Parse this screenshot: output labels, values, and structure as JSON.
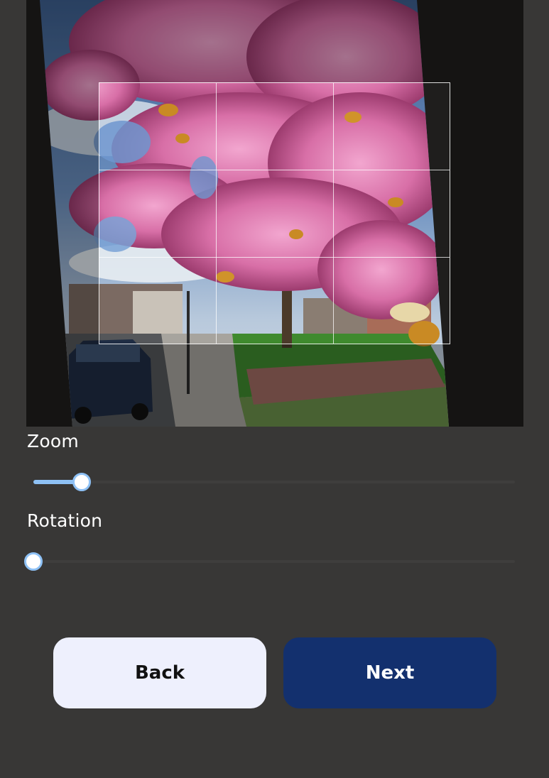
{
  "crop_editor": {
    "grid": "3x3",
    "image_description_icon": "photo-image"
  },
  "controls": {
    "zoom": {
      "label": "Zoom",
      "value_fraction": 0.1
    },
    "rotation": {
      "label": "Rotation",
      "value_fraction": 0.0
    }
  },
  "buttons": {
    "back_label": "Back",
    "next_label": "Next"
  },
  "colors": {
    "background": "#383736",
    "slider_accent": "#8ec1f5",
    "back_button": "#eef0fd",
    "next_button": "#13306e"
  }
}
